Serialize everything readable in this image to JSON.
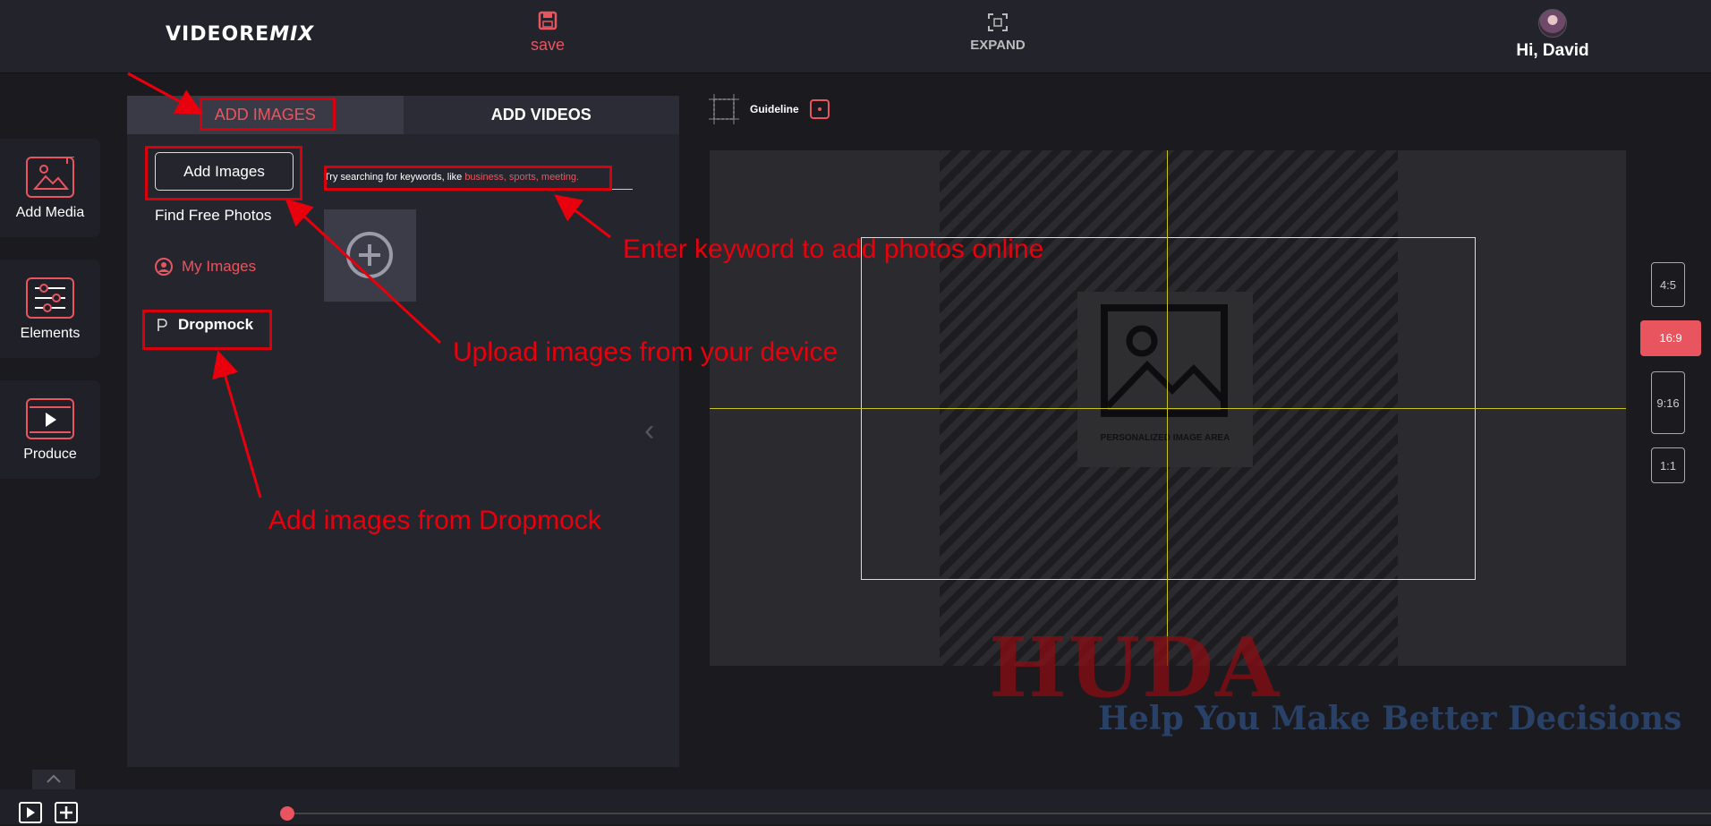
{
  "header": {
    "logo_prefix": "VIDEORE",
    "logo_suffix": "MIX",
    "save_label": "save",
    "expand_label": "EXPAND",
    "greeting": "Hi, David"
  },
  "rail": {
    "items": [
      {
        "label": "Add Media"
      },
      {
        "label": "Elements"
      },
      {
        "label": "Produce"
      }
    ]
  },
  "panel": {
    "tabs": [
      {
        "label": "ADD IMAGES",
        "active": true
      },
      {
        "label": "ADD VIDEOS",
        "active": false
      }
    ],
    "add_images_button": "Add Images",
    "find_free_photos": "Find Free Photos",
    "my_images": "My Images",
    "dropmock": "Dropmock",
    "search_hint_prefix": "Try searching for keywords, like ",
    "search_hint_keywords": "business, sports, meeting."
  },
  "editor": {
    "guideline_label": "Guideline",
    "image_area_caption": "PERSONALIZED IMAGE AREA",
    "ratios": [
      "4:5",
      "16:9",
      "9:16",
      "1:1"
    ],
    "selected_ratio": "16:9"
  },
  "annotations": {
    "keyword": "Enter keyword to add photos online",
    "upload": "Upload images from your device",
    "dropmock": "Add images from Dropmock"
  },
  "watermark": {
    "brand": "HUDA",
    "tagline": "Help You Make Better Decisions"
  },
  "colors": {
    "accent": "#e9555f",
    "annotation_red": "#e8000c",
    "guide_yellow": "#c9c31a"
  }
}
